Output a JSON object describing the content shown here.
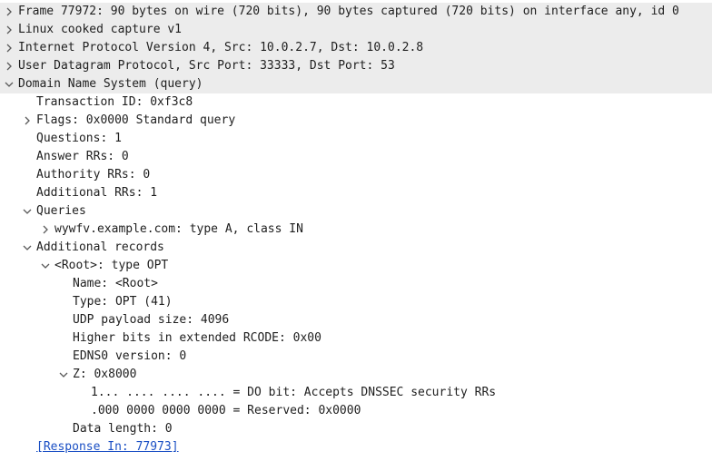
{
  "tree": {
    "frame": "Frame 77972: 90 bytes on wire (720 bits), 90 bytes captured (720 bits) on interface any, id 0",
    "linux": "Linux cooked capture v1",
    "ip": "Internet Protocol Version 4, Src: 10.0.2.7, Dst: 10.0.2.8",
    "udp": "User Datagram Protocol, Src Port: 33333, Dst Port: 53",
    "dns": "Domain Name System (query)",
    "transaction_id": "Transaction ID: 0xf3c8",
    "flags": "Flags: 0x0000 Standard query",
    "questions": "Questions: 1",
    "answer_rrs": "Answer RRs: 0",
    "authority_rrs": "Authority RRs: 0",
    "additional_rrs": "Additional RRs: 1",
    "queries": "Queries",
    "query_item": "wywfv.example.com: type A, class IN",
    "additional_records": "Additional records",
    "root_opt": "<Root>: type OPT",
    "name": "Name: <Root>",
    "type": "Type: OPT (41)",
    "udp_payload": "UDP payload size: 4096",
    "higher_bits": "Higher bits in extended RCODE: 0x00",
    "edns0": "EDNS0 version: 0",
    "z": "Z: 0x8000",
    "do_bit": "1... .... .... .... = DO bit: Accepts DNSSEC security RRs",
    "reserved": ".000 0000 0000 0000 = Reserved: 0x0000",
    "data_length": "Data length: 0",
    "response_in": "[Response In: 77973]"
  }
}
